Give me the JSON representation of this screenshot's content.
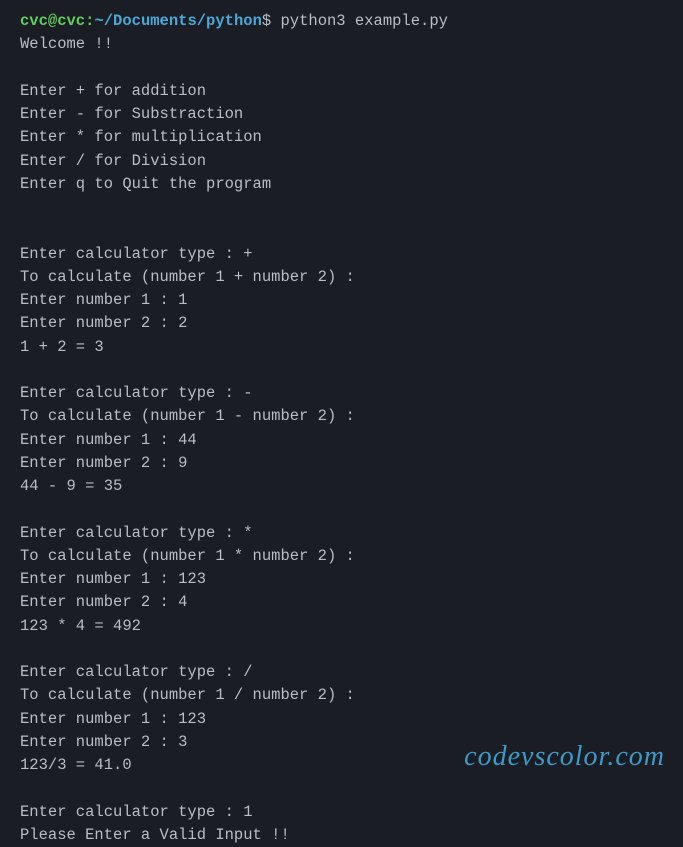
{
  "prompt": {
    "user": "cvc@cvc",
    "separator": ":",
    "path": "~/Documents/python",
    "dollar": "$",
    "command": "python3 example.py"
  },
  "output": {
    "welcome": "Welcome !!",
    "blank": "",
    "menu1": "Enter + for addition",
    "menu2": "Enter - for Substraction",
    "menu3": "Enter * for multiplication",
    "menu4": "Enter / for Division",
    "menu5": "Enter q to Quit the program",
    "op1_type": "Enter calculator type : +",
    "op1_prompt": "To calculate (number 1 + number 2) :",
    "op1_num1": "Enter number 1 : 1",
    "op1_num2": "Enter number 2 : 2",
    "op1_result": "1 + 2 = 3",
    "op2_type": "Enter calculator type : -",
    "op2_prompt": "To calculate (number 1 - number 2) :",
    "op2_num1": "Enter number 1 : 44",
    "op2_num2": "Enter number 2 : 9",
    "op2_result": "44 - 9 = 35",
    "op3_type": "Enter calculator type : *",
    "op3_prompt": "To calculate (number 1 * number 2) :",
    "op3_num1": "Enter number 1 : 123",
    "op3_num2": "Enter number 2 : 4",
    "op3_result": "123 * 4 = 492",
    "op4_type": "Enter calculator type : /",
    "op4_prompt": "To calculate (number 1 / number 2) :",
    "op4_num1": "Enter number 1 : 123",
    "op4_num2": "Enter number 2 : 3",
    "op4_result": "123/3 = 41.0",
    "op5_type": "Enter calculator type : 1",
    "op5_error": "Please Enter a Valid Input !!"
  },
  "watermark": "codevscolor.com"
}
